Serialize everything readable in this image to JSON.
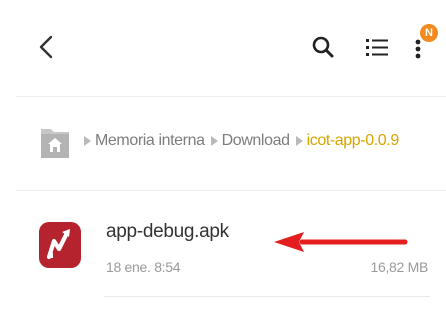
{
  "toolbar": {
    "back_icon": "back-chevron-icon",
    "search_icon": "search-icon",
    "list_icon": "list-view-icon",
    "more_icon": "more-vert-icon",
    "notification_badge": "N",
    "badge_color": "#f28a1e"
  },
  "breadcrumb": {
    "home_icon": "home-folder-icon",
    "items": [
      "Memoria interna",
      "Download",
      "icot-app-0.0.9"
    ],
    "current_color": "#d7a400"
  },
  "files": [
    {
      "icon": "app-apk-icon",
      "icon_color": "#b5232e",
      "name": "app-debug.apk",
      "date": "18 ene. 8:54",
      "size": "16,82 MB"
    }
  ],
  "annotation": {
    "arrow_icon": "red-pointer-arrow",
    "color": "#e41e1e"
  }
}
